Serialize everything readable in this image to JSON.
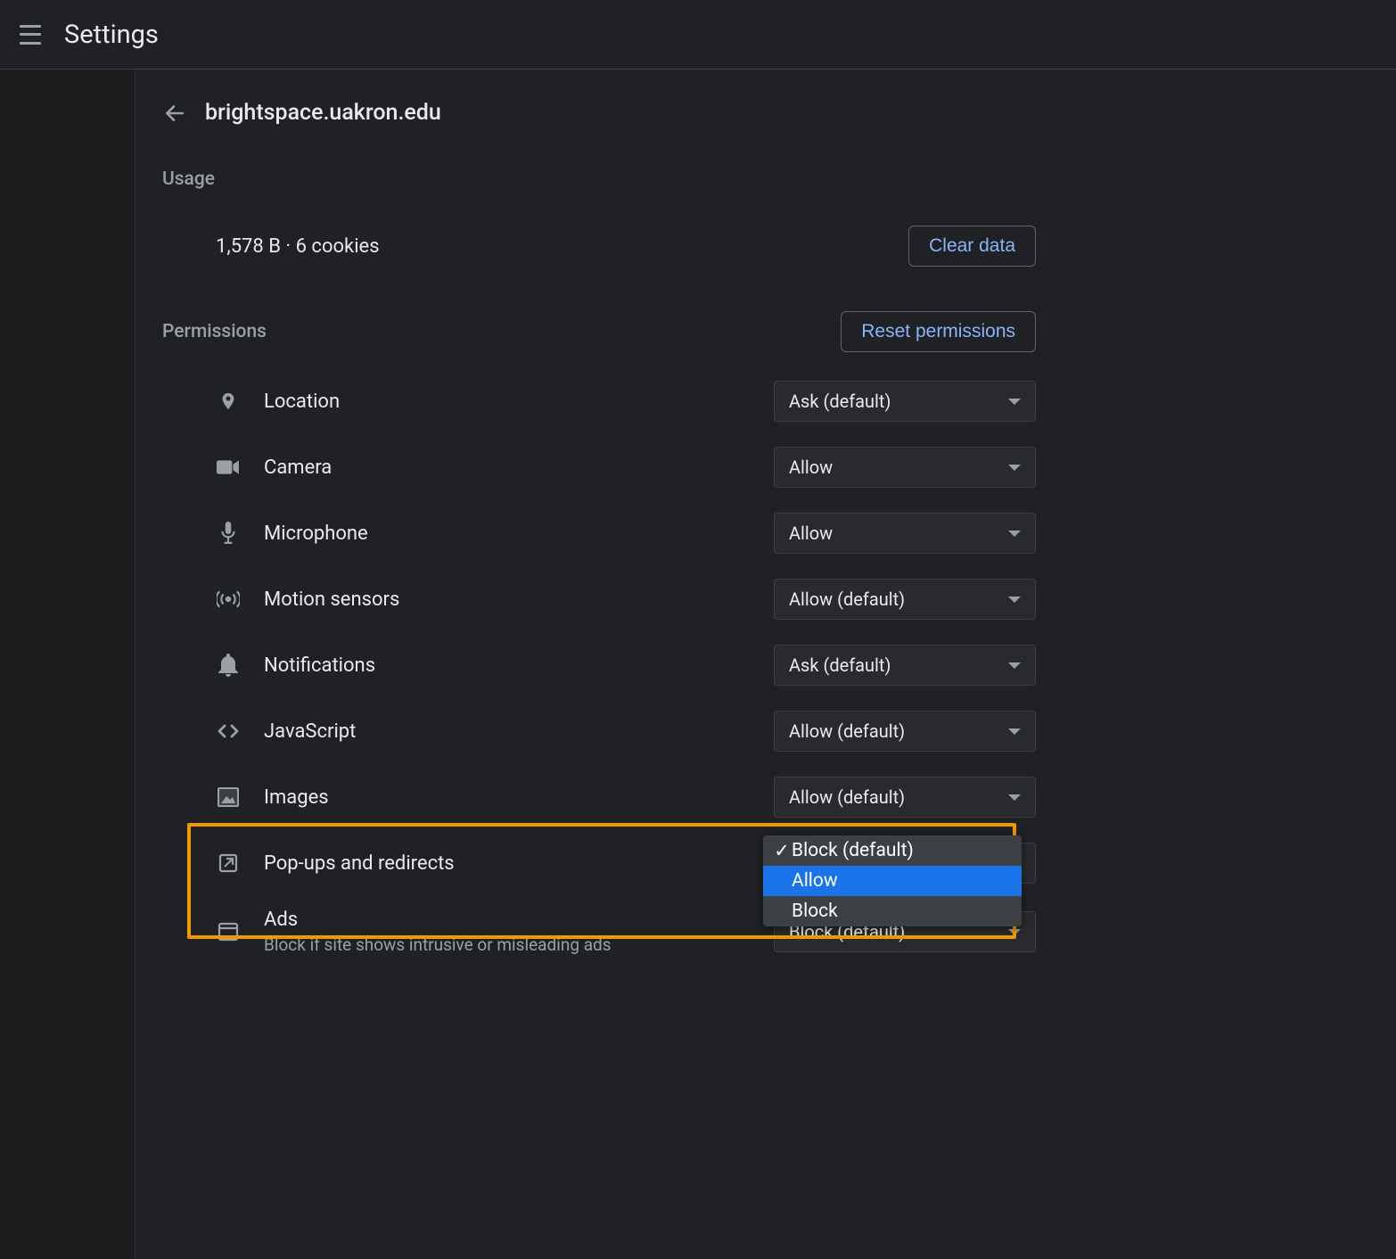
{
  "topbar": {
    "title": "Settings"
  },
  "page": {
    "site_title": "brightspace.uakron.edu",
    "usage_heading": "Usage",
    "usage_text": "1,578 B · 6 cookies",
    "clear_data_label": "Clear data",
    "permissions_heading": "Permissions",
    "reset_permissions_label": "Reset permissions"
  },
  "permissions": [
    {
      "id": "location",
      "label": "Location",
      "value": "Ask (default)"
    },
    {
      "id": "camera",
      "label": "Camera",
      "value": "Allow"
    },
    {
      "id": "microphone",
      "label": "Microphone",
      "value": "Allow"
    },
    {
      "id": "motion",
      "label": "Motion sensors",
      "value": "Allow (default)"
    },
    {
      "id": "notifications",
      "label": "Notifications",
      "value": "Ask (default)"
    },
    {
      "id": "javascript",
      "label": "JavaScript",
      "value": "Allow (default)"
    },
    {
      "id": "images",
      "label": "Images",
      "value": "Allow (default)"
    },
    {
      "id": "popups",
      "label": "Pop-ups and redirects",
      "value": "Block (default)"
    },
    {
      "id": "ads",
      "label": "Ads",
      "sublabel": "Block if site shows intrusive or misleading ads",
      "value": "Block (default)"
    }
  ],
  "dropdown": {
    "options": [
      {
        "label": "Block (default)",
        "checked": true,
        "selected": false
      },
      {
        "label": "Allow",
        "checked": false,
        "selected": true
      },
      {
        "label": "Block",
        "checked": false,
        "selected": false
      }
    ]
  }
}
